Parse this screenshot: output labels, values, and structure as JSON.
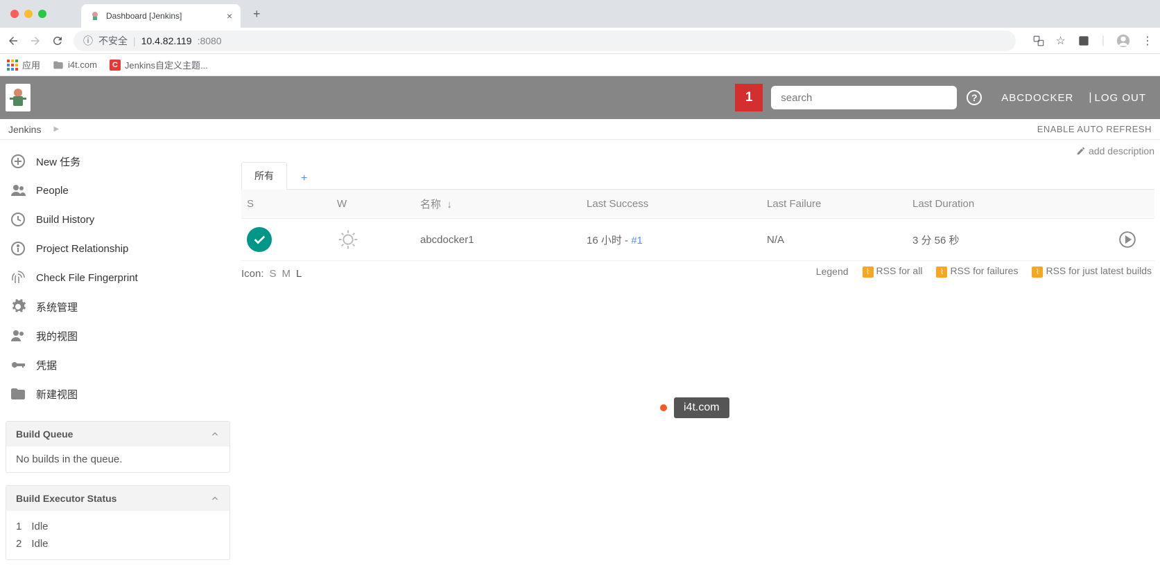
{
  "browser": {
    "tab_title": "Dashboard [Jenkins]",
    "address_insecure": "不安全",
    "address_host": "10.4.82.119",
    "address_port": ":8080"
  },
  "bookmarks": {
    "apps": "应用",
    "i4t": "i4t.com",
    "jenkins_theme": "Jenkins自定义主题..."
  },
  "header": {
    "notif_count": "1",
    "search_placeholder": "search",
    "user": "ABCDOCKER",
    "logout": "LOG OUT"
  },
  "breadcrumb": {
    "root": "Jenkins",
    "auto_refresh": "ENABLE AUTO REFRESH"
  },
  "sidebar": {
    "items": [
      "New 任务",
      "People",
      "Build History",
      "Project Relationship",
      "Check File Fingerprint",
      "系统管理",
      "我的视图",
      "凭据",
      "新建视图"
    ],
    "build_queue_title": "Build Queue",
    "build_queue_empty": "No builds in the queue.",
    "executor_title": "Build Executor Status",
    "executors": [
      {
        "num": "1",
        "state": "Idle"
      },
      {
        "num": "2",
        "state": "Idle"
      }
    ]
  },
  "content": {
    "add_description": "add description",
    "tab_all": "所有",
    "table": {
      "headers": {
        "s": "S",
        "w": "W",
        "name": "名称",
        "name_arrow": "↓",
        "last_success": "Last Success",
        "last_failure": "Last Failure",
        "last_duration": "Last Duration"
      },
      "row": {
        "name": "abcdocker1",
        "last_success_time": "16 小时 - ",
        "last_success_build": "#1",
        "last_failure": "N/A",
        "last_duration": "3 分 56 秒"
      }
    },
    "icon_label": "Icon:",
    "icon_sizes": {
      "s": "S",
      "m": "M",
      "l": "L"
    },
    "footer": {
      "legend": "Legend",
      "rss_all": "RSS for all",
      "rss_failures": "RSS for failures",
      "rss_latest": "RSS for just latest builds"
    }
  },
  "watermark": "i4t.com"
}
